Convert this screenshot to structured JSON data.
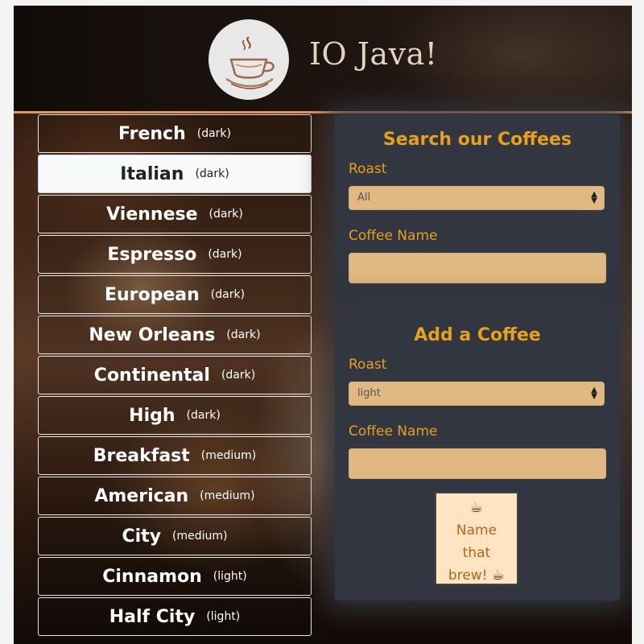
{
  "header": {
    "title": "IO Java!",
    "logo_icon": "coffee-cup-icon"
  },
  "coffees": [
    {
      "name": "French",
      "roast": "(dark)"
    },
    {
      "name": "Italian",
      "roast": "(dark)"
    },
    {
      "name": "Viennese",
      "roast": "(dark)"
    },
    {
      "name": "Espresso",
      "roast": "(dark)"
    },
    {
      "name": "European",
      "roast": "(dark)"
    },
    {
      "name": "New Orleans",
      "roast": "(dark)"
    },
    {
      "name": "Continental",
      "roast": "(dark)"
    },
    {
      "name": "High",
      "roast": "(dark)"
    },
    {
      "name": "Breakfast",
      "roast": "(medium)"
    },
    {
      "name": "American",
      "roast": "(medium)"
    },
    {
      "name": "City",
      "roast": "(medium)"
    },
    {
      "name": "Cinnamon",
      "roast": "(light)"
    },
    {
      "name": "Half City",
      "roast": "(light)"
    }
  ],
  "search": {
    "title": "Search our Coffees",
    "roast_label": "Roast",
    "roast_selected": "All",
    "name_label": "Coffee Name",
    "name_value": ""
  },
  "add": {
    "title": "Add a Coffee",
    "roast_label": "Roast",
    "roast_selected": "light",
    "name_label": "Coffee Name",
    "name_value": "",
    "button_lines": [
      "Name",
      "that",
      "brew!"
    ],
    "button_icon": "coffee-icon"
  },
  "colors": {
    "accent": "#e6a11c",
    "panel": "#323640",
    "input_bg": "#e0b982",
    "header_border": "#e8935f",
    "button_bg": "#ffe4c2"
  }
}
